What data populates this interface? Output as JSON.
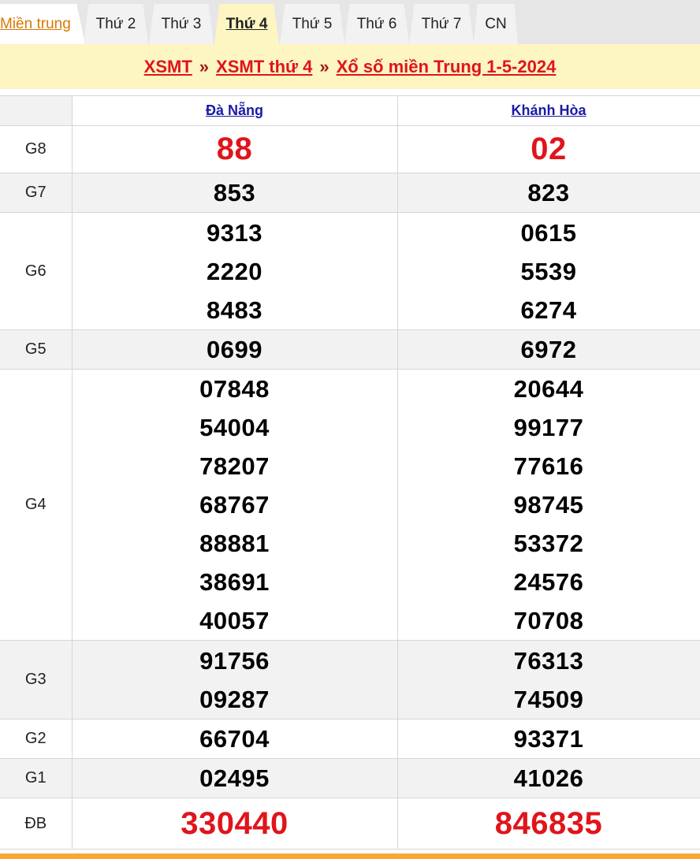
{
  "tabs": [
    {
      "label": "Miền trung",
      "active": false
    },
    {
      "label": "Thứ 2",
      "active": false
    },
    {
      "label": "Thứ 3",
      "active": false
    },
    {
      "label": "Thứ 4",
      "active": true
    },
    {
      "label": "Thứ 5",
      "active": false
    },
    {
      "label": "Thứ 6",
      "active": false
    },
    {
      "label": "Thứ 7",
      "active": false
    },
    {
      "label": "CN",
      "active": false
    }
  ],
  "breadcrumb": {
    "items": [
      "XSMT",
      "XSMT thứ 4",
      "Xổ số miền Trung 1-5-2024"
    ],
    "separator": "»"
  },
  "results": {
    "provinces": [
      "Đà Nẵng",
      "Khánh Hòa"
    ],
    "prizes": [
      {
        "label": "G8",
        "values": [
          [
            "88"
          ],
          [
            "02"
          ]
        ]
      },
      {
        "label": "G7",
        "values": [
          [
            "853"
          ],
          [
            "823"
          ]
        ]
      },
      {
        "label": "G6",
        "values": [
          [
            "9313",
            "2220",
            "8483"
          ],
          [
            "0615",
            "5539",
            "6274"
          ]
        ]
      },
      {
        "label": "G5",
        "values": [
          [
            "0699"
          ],
          [
            "6972"
          ]
        ]
      },
      {
        "label": "G4",
        "values": [
          [
            "07848",
            "54004",
            "78207",
            "68767",
            "88881",
            "38691",
            "40057"
          ],
          [
            "20644",
            "99177",
            "77616",
            "98745",
            "53372",
            "24576",
            "70708"
          ]
        ]
      },
      {
        "label": "G3",
        "values": [
          [
            "91756",
            "09287"
          ],
          [
            "76313",
            "74509"
          ]
        ]
      },
      {
        "label": "G2",
        "values": [
          [
            "66704"
          ],
          [
            "93371"
          ]
        ]
      },
      {
        "label": "G1",
        "values": [
          [
            "02495"
          ],
          [
            "41026"
          ]
        ]
      },
      {
        "label": "ĐB",
        "values": [
          [
            "330440"
          ],
          [
            "846835"
          ]
        ]
      }
    ]
  },
  "colors": {
    "accent_red": "#e0141b",
    "link_blue": "#1a1aa6",
    "header_yellow": "#fdf5c2",
    "tab_orange": "#d97800",
    "bottom_bar": "#f7a833"
  }
}
